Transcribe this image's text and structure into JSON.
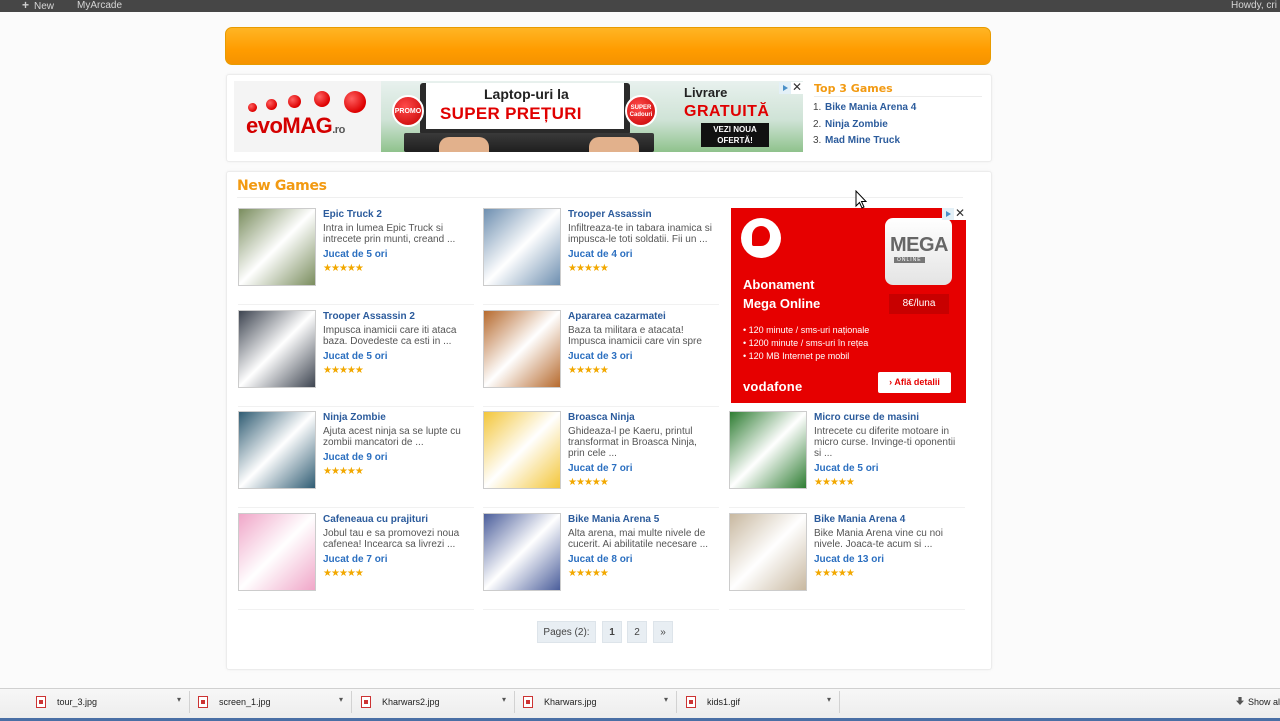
{
  "adminbar": {
    "new_label": "New",
    "site_label": "MyArcade",
    "howdy": "Howdy, cri"
  },
  "top_ad": {
    "brand": "evoMAG",
    "brand_tld": ".ro",
    "promo_badge": "PROMO",
    "super_badge": "SUPER Cadouri",
    "line1": "Laptop-uri la",
    "line2": "SUPER PREȚURI",
    "line3": "Livrare",
    "line4": "GRATUITĂ",
    "cta": "VEZI NOUA OFERTĂ!",
    "close": "✕"
  },
  "top3": {
    "title": "Top 3 Games",
    "items": [
      {
        "num": "1.",
        "name": "Bike Mania Arena 4"
      },
      {
        "num": "2.",
        "name": "Ninja Zombie"
      },
      {
        "num": "3.",
        "name": "Mad Mine Truck"
      }
    ]
  },
  "new_games": {
    "title": "New Games",
    "games": [
      {
        "title": "Epic Truck 2",
        "desc": "Intra in lumea Epic Truck si intrecete prin munti, creand ...",
        "played": "Jucat de 5 ori",
        "rating": 5,
        "thumb_color": "#7a8d5e"
      },
      {
        "title": "Trooper Assassin",
        "desc": "Infiltreaza-te in tabara inamica si impusca-le toti soldatii. Fii un ...",
        "played": "Jucat de 4 ori",
        "rating": 5,
        "thumb_color": "#6e8fb0"
      },
      {
        "title": "Trooper Assassin 2",
        "desc": "Impusca inamicii care iti ataca baza. Dovedeste ca esti in ...",
        "played": "Jucat de 5 ori",
        "rating": 5,
        "thumb_color": "#3d4450"
      },
      {
        "title": "Apararea cazarmatei",
        "desc": "Baza ta militara e atacata! Impusca inamicii care vin spre ...",
        "played": "Jucat de 3 ori",
        "rating": 5,
        "thumb_color": "#b66a2e"
      },
      {
        "title": "Ninja Zombie",
        "desc": "Ajuta acest ninja sa se lupte cu zombii mancatori de ...",
        "played": "Jucat de 9 ori",
        "rating": 5,
        "thumb_color": "#2f5c73"
      },
      {
        "title": "Broasca Ninja",
        "desc": "Ghideaza-l pe Kaeru, printul transformat in Broasca Ninja, prin cele ...",
        "played": "Jucat de 7 ori",
        "rating": 5,
        "thumb_color": "#f3c63a"
      },
      {
        "title": "Micro curse de masini",
        "desc": "Intrecete cu diferite motoare in micro curse. Invinge-ti oponentii si ...",
        "played": "Jucat de 5 ori",
        "rating": 5,
        "thumb_color": "#2e7d32"
      },
      {
        "title": "Cafeneaua cu prajituri",
        "desc": "Jobul tau e sa promovezi noua cafenea! Incearca sa livrezi ...",
        "played": "Jucat de 7 ori",
        "rating": 5,
        "thumb_color": "#f0a6c8"
      },
      {
        "title": "Bike Mania Arena 5",
        "desc": "Alta arena, mai multe nivele de cucerit. Ai abilitatile necesare ...",
        "played": "Jucat de 8 ori",
        "rating": 5,
        "thumb_color": "#4b5e9b"
      },
      {
        "title": "Bike Mania Arena 4",
        "desc": "Bike Mania Arena vine cu noi nivele. Joaca-te acum si ...",
        "played": "Jucat de 13 ori",
        "rating": 5,
        "thumb_color": "#c8b8a0"
      }
    ]
  },
  "side_ad": {
    "mega": "MEGA",
    "online": "ONLINE",
    "price": "8€/luna",
    "headline1": "Abonament",
    "headline2": "Mega Online",
    "bullets": [
      "120 minute / sms-uri naționale",
      "1200 minute / sms-uri în rețea",
      "120 MB Internet pe mobil"
    ],
    "brand": "vodafone",
    "cta": "› Află detalii",
    "close": "✕"
  },
  "pagination": {
    "label": "Pages (2):",
    "pages": [
      "1",
      "2"
    ],
    "next": "»"
  },
  "taskbar": {
    "files": [
      "tour_3.jpg",
      "screen_1.jpg",
      "Kharwars2.jpg",
      "Kharwars.jpg",
      "kids1.gif"
    ],
    "caret": "▾",
    "show_all": "Show al"
  },
  "colors": {
    "accent_orange": "#ff9c00",
    "title_orange": "#f29a12",
    "link_blue": "#2b5b9c",
    "star_gold": "#f2a800",
    "vodafone_red": "#e60000"
  }
}
